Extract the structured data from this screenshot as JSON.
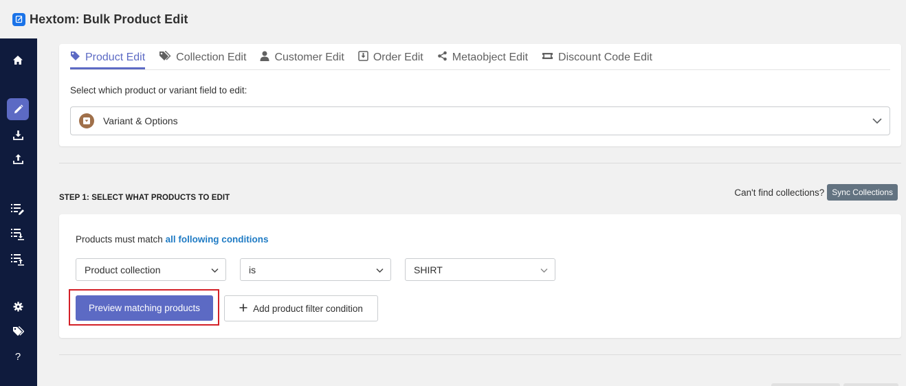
{
  "app": {
    "title": "Hextom: Bulk Product Edit",
    "icon": "edit-note-icon",
    "accent_color": "#5c6ac4"
  },
  "sidebar": {
    "items": [
      {
        "name": "home",
        "icon": "home-icon"
      },
      {
        "name": "bulk-edit",
        "icon": "pencil-icon",
        "active": true
      },
      {
        "name": "import",
        "icon": "download-icon"
      },
      {
        "name": "export",
        "icon": "upload-icon"
      },
      {
        "name": "edit-tasks",
        "icon": "list-edit-icon"
      },
      {
        "name": "import-tasks",
        "icon": "list-download-icon"
      },
      {
        "name": "export-tasks",
        "icon": "list-upload-icon"
      },
      {
        "name": "settings",
        "icon": "gear-icon"
      },
      {
        "name": "tags",
        "icon": "tags-icon"
      },
      {
        "name": "help",
        "icon": "question-icon",
        "label": "?"
      }
    ]
  },
  "tabs": [
    {
      "label": "Product Edit",
      "icon": "tag-icon",
      "active": true
    },
    {
      "label": "Collection Edit",
      "icon": "tags-icon"
    },
    {
      "label": "Customer Edit",
      "icon": "user-icon"
    },
    {
      "label": "Order Edit",
      "icon": "download-box-icon"
    },
    {
      "label": "Metaobject Edit",
      "icon": "share-icon"
    },
    {
      "label": "Discount Code Edit",
      "icon": "ticket-icon"
    }
  ],
  "field_select": {
    "label": "Select which product or variant field to edit:",
    "value": "Variant & Options",
    "icon": "variant-box-icon"
  },
  "step1": {
    "title": "STEP 1: SELECT WHAT PRODUCTS TO EDIT",
    "sync_prompt": "Can't find collections?",
    "sync_button": "Sync Collections"
  },
  "conditions": {
    "prefix": "Products must match",
    "match_link": "all following conditions",
    "rule": {
      "field": "Product collection",
      "operator": "is",
      "value": "SHIRT"
    },
    "preview_button": "Preview matching products",
    "add_button": "Add product filter condition"
  }
}
